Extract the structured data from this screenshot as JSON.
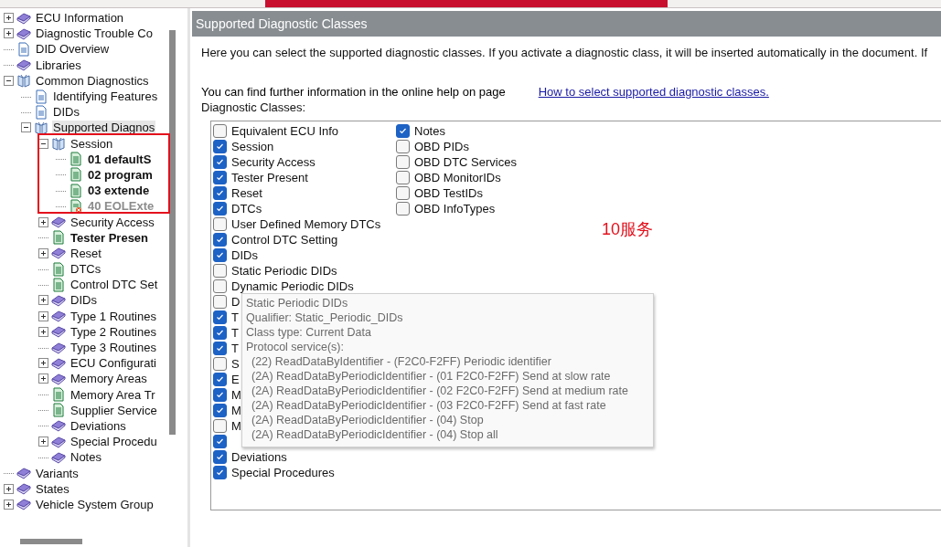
{
  "tree": [
    {
      "label": "ECU Information",
      "kind": "book",
      "expanded": false,
      "bold": false,
      "disabled": false,
      "selected": false
    },
    {
      "label": "Diagnostic Trouble Co",
      "kind": "book",
      "expanded": false,
      "bold": false,
      "disabled": false,
      "selected": false
    },
    {
      "label": "DID Overview",
      "kind": "doc",
      "bold": false,
      "disabled": false,
      "selected": false
    },
    {
      "label": "Libraries",
      "kind": "book",
      "bold": false,
      "disabled": false,
      "selected": false
    },
    {
      "label": "Common Diagnostics",
      "kind": "open-book",
      "expanded": true,
      "bold": false,
      "disabled": false,
      "selected": false,
      "children": [
        {
          "label": "Identifying Features",
          "kind": "doc",
          "bold": false,
          "disabled": false,
          "selected": false
        },
        {
          "label": "DIDs",
          "kind": "doc",
          "bold": false,
          "disabled": false,
          "selected": false
        },
        {
          "label": "Supported Diagnos",
          "kind": "open-book",
          "expanded": true,
          "bold": false,
          "disabled": false,
          "selected": true,
          "children": [
            {
              "label": "Session",
              "kind": "open-book",
              "expanded": true,
              "bold": false,
              "disabled": false,
              "selected": false,
              "children": [
                {
                  "label": "01 defaultS",
                  "kind": "green-doc",
                  "bold": true,
                  "disabled": false,
                  "selected": false
                },
                {
                  "label": "02 program",
                  "kind": "green-doc",
                  "bold": true,
                  "disabled": false,
                  "selected": false
                },
                {
                  "label": "03 extende",
                  "kind": "green-doc",
                  "bold": true,
                  "disabled": false,
                  "selected": false
                },
                {
                  "label": "40 EOLExte",
                  "kind": "error-doc",
                  "bold": true,
                  "disabled": true,
                  "selected": false
                }
              ]
            },
            {
              "label": "Security Access",
              "kind": "book",
              "expanded": false,
              "bold": false,
              "disabled": false,
              "selected": false
            },
            {
              "label": "Tester Presen",
              "kind": "green-doc",
              "bold": true,
              "disabled": false,
              "selected": false
            },
            {
              "label": "Reset",
              "kind": "book",
              "expanded": false,
              "bold": false,
              "disabled": false,
              "selected": false
            },
            {
              "label": "DTCs",
              "kind": "green-doc",
              "bold": false,
              "disabled": false,
              "selected": false
            },
            {
              "label": "Control DTC Set",
              "kind": "green-doc",
              "bold": false,
              "disabled": false,
              "selected": false
            },
            {
              "label": "DIDs",
              "kind": "book",
              "expanded": false,
              "bold": false,
              "disabled": false,
              "selected": false
            },
            {
              "label": "Type 1 Routines",
              "kind": "book",
              "expanded": false,
              "bold": false,
              "disabled": false,
              "selected": false
            },
            {
              "label": "Type 2 Routines",
              "kind": "book",
              "expanded": false,
              "bold": false,
              "disabled": false,
              "selected": false
            },
            {
              "label": "Type 3 Routines",
              "kind": "book",
              "bold": false,
              "disabled": false,
              "selected": false
            },
            {
              "label": "ECU Configurati",
              "kind": "book",
              "expanded": false,
              "bold": false,
              "disabled": false,
              "selected": false
            },
            {
              "label": "Memory Areas",
              "kind": "book",
              "expanded": false,
              "bold": false,
              "disabled": false,
              "selected": false
            },
            {
              "label": "Memory Area Tr",
              "kind": "green-doc",
              "bold": false,
              "disabled": false,
              "selected": false
            },
            {
              "label": "Supplier Service",
              "kind": "green-doc",
              "bold": false,
              "disabled": false,
              "selected": false
            },
            {
              "label": "Deviations",
              "kind": "book",
              "bold": false,
              "disabled": false,
              "selected": false
            },
            {
              "label": "Special Procedu",
              "kind": "book",
              "expanded": false,
              "bold": false,
              "disabled": false,
              "selected": false
            },
            {
              "label": "Notes",
              "kind": "book",
              "bold": false,
              "disabled": false,
              "selected": false
            }
          ]
        }
      ]
    },
    {
      "label": "Variants",
      "kind": "book",
      "bold": false,
      "disabled": false,
      "selected": false
    },
    {
      "label": "States",
      "kind": "book",
      "expanded": false,
      "bold": false,
      "disabled": false,
      "selected": false
    },
    {
      "label": "Vehicle System Group",
      "kind": "book",
      "expanded": false,
      "bold": false,
      "disabled": false,
      "selected": false
    }
  ],
  "panel": {
    "title": "Supported Diagnostic Classes",
    "intro": "Here you can select the supported diagnostic classes. If you activate a diagnostic class, it will be inserted automatically in the document. If",
    "help_text": "You can find further information in the online help on page",
    "help_link": "How to select supported diagnostic classes.",
    "classes_label": "Diagnostic Classes:",
    "columns": [
      [
        {
          "label": "Equivalent ECU Info",
          "checked": false
        },
        {
          "label": "Session",
          "checked": true
        },
        {
          "label": "Security Access",
          "checked": true
        },
        {
          "label": "Tester Present",
          "checked": true
        },
        {
          "label": "Reset",
          "checked": true
        },
        {
          "label": "DTCs",
          "checked": true
        },
        {
          "label": "User Defined Memory DTCs",
          "checked": false
        },
        {
          "label": "Control DTC Setting",
          "checked": true
        },
        {
          "label": "DIDs",
          "checked": true
        },
        {
          "label": "Static Periodic DIDs",
          "checked": false
        },
        {
          "label": "Dynamic Periodic DIDs",
          "checked": false
        },
        {
          "label": "D",
          "checked": false
        },
        {
          "label": "T",
          "checked": true
        },
        {
          "label": "T",
          "checked": true
        },
        {
          "label": "T",
          "checked": true
        },
        {
          "label": "S",
          "checked": false
        },
        {
          "label": "E",
          "checked": true
        },
        {
          "label": "M",
          "checked": true
        },
        {
          "label": "M",
          "checked": true
        },
        {
          "label": "M",
          "checked": false
        },
        {
          "checked": true
        },
        {
          "label": "Deviations",
          "checked": true
        },
        {
          "label": "Special Procedures",
          "checked": true
        }
      ],
      [
        {
          "label": "Notes",
          "checked": true
        },
        {
          "label": "OBD PIDs",
          "checked": false
        },
        {
          "label": "OBD DTC Services",
          "checked": false
        },
        {
          "label": "OBD MonitorIDs",
          "checked": false
        },
        {
          "label": "OBD TestIDs",
          "checked": false
        },
        {
          "label": "OBD InfoTypes",
          "checked": false
        }
      ]
    ],
    "tooltip": {
      "lines": [
        "Static Periodic DIDs",
        "Qualifier: Static_Periodic_DIDs",
        "Class type: Current Data",
        "Protocol service(s):"
      ],
      "services": [
        "(22) ReadDataByIdentifier - (F2C0-F2FF) Periodic identifier",
        "(2A) ReadDataByPeriodicIdentifier - (01 F2C0-F2FF) Send at slow rate",
        "(2A) ReadDataByPeriodicIdentifier - (02 F2C0-F2FF) Send at medium rate",
        "(2A) ReadDataByPeriodicIdentifier - (03 F2C0-F2FF) Send at fast rate",
        "(2A) ReadDataByPeriodicIdentifier - (04) Stop",
        "(2A) ReadDataByPeriodicIdentifier - (04) Stop all"
      ]
    },
    "annotation": "10服务"
  }
}
